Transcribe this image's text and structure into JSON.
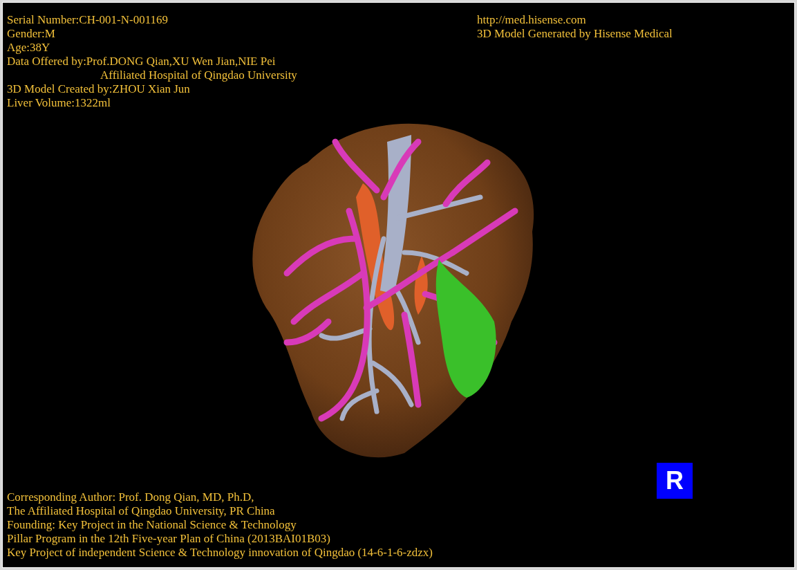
{
  "header_left": [
    {
      "text": "Serial Number:CH-001-N-001169",
      "kind": "line"
    },
    {
      "text": "Gender:M",
      "kind": "line"
    },
    {
      "text": "Age:38Y",
      "kind": "line"
    },
    {
      "text": "Data Offered by:Prof.DONG Qian,XU Wen Jian,NIE Pei",
      "kind": "line"
    },
    {
      "text": "Affiliated Hospital of Qingdao University",
      "kind": "continuation"
    },
    {
      "text": "3D Model Created by:ZHOU Xian Jun",
      "kind": "line"
    },
    {
      "text": "Liver Volume:1322ml",
      "kind": "line"
    }
  ],
  "header_right": [
    {
      "text": "http://med.hisense.com",
      "kind": "line"
    },
    {
      "text": "3D Model Generated by Hisense Medical",
      "kind": "line"
    }
  ],
  "orientation_badge": {
    "label": "R"
  },
  "footer": [
    {
      "text": "Corresponding Author: Prof. Dong Qian, MD, Ph.D,",
      "kind": "line"
    },
    {
      "text": "The Affiliated Hospital of Qingdao University, PR China",
      "kind": "line"
    },
    {
      "text": "Founding: Key Project in the National Science & Technology",
      "kind": "line"
    },
    {
      "text": "Pillar Program in the 12th Five-year Plan of China (2013BAI01B03)",
      "kind": "line"
    },
    {
      "text": "Key Project of independent Science & Technology innovation of Qingdao (14-6-1-6-zdzx)",
      "kind": "line"
    }
  ]
}
